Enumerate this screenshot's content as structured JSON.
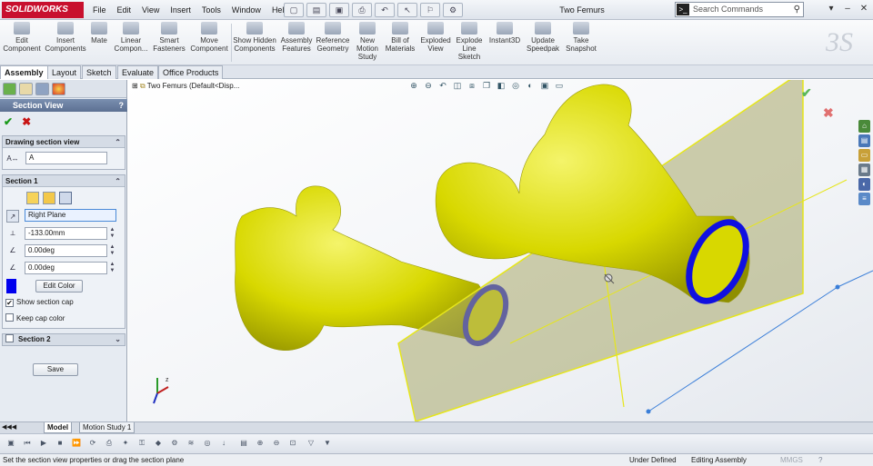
{
  "app": {
    "logo_text": "SOLIDWORKS",
    "doc_title": "Two Femurs"
  },
  "menu": [
    "File",
    "Edit",
    "View",
    "Insert",
    "Tools",
    "Window",
    "Help"
  ],
  "search": {
    "placeholder": "Search Commands"
  },
  "ribbon": [
    "Edit Component",
    "Insert Components",
    "Mate",
    "Linear Compon...",
    "Smart Fasteners",
    "Move Component",
    "Show Hidden Components",
    "Assembly Features",
    "Reference Geometry",
    "New Motion Study",
    "Bill of Materials",
    "Exploded View",
    "Explode Line Sketch",
    "Instant3D",
    "Update Speedpak",
    "Take Snapshot"
  ],
  "tabs": [
    "Assembly",
    "Layout",
    "Sketch",
    "Evaluate",
    "Office Products"
  ],
  "panel": {
    "title": "Section View",
    "help": "?",
    "drawing_section": {
      "label": "Drawing section view",
      "name": "A"
    },
    "section1": {
      "label": "Section 1",
      "plane": "Right Plane",
      "offset": "-133.00mm",
      "angle_x": "0.00deg",
      "angle_y": "0.00deg",
      "edit_color": "Edit Color",
      "cap_color": "#0000ee",
      "show_section_cap": {
        "label": "Show section cap",
        "checked": true
      },
      "keep_cap_color": {
        "label": "Keep cap color",
        "checked": false
      }
    },
    "section2": {
      "label": "Section 2"
    },
    "save": "Save"
  },
  "viewport": {
    "tree_label": "Two Femurs  (Default<Disp...",
    "bone_color": "#d8d800",
    "plane_color": "#a8a86a"
  },
  "bottom_tabs": [
    "Model",
    "Motion Study 1"
  ],
  "status": {
    "hint": "Set the section view properties or drag the section plane",
    "defined": "Under Defined",
    "mode": "Editing Assembly",
    "units": "MMGS"
  }
}
